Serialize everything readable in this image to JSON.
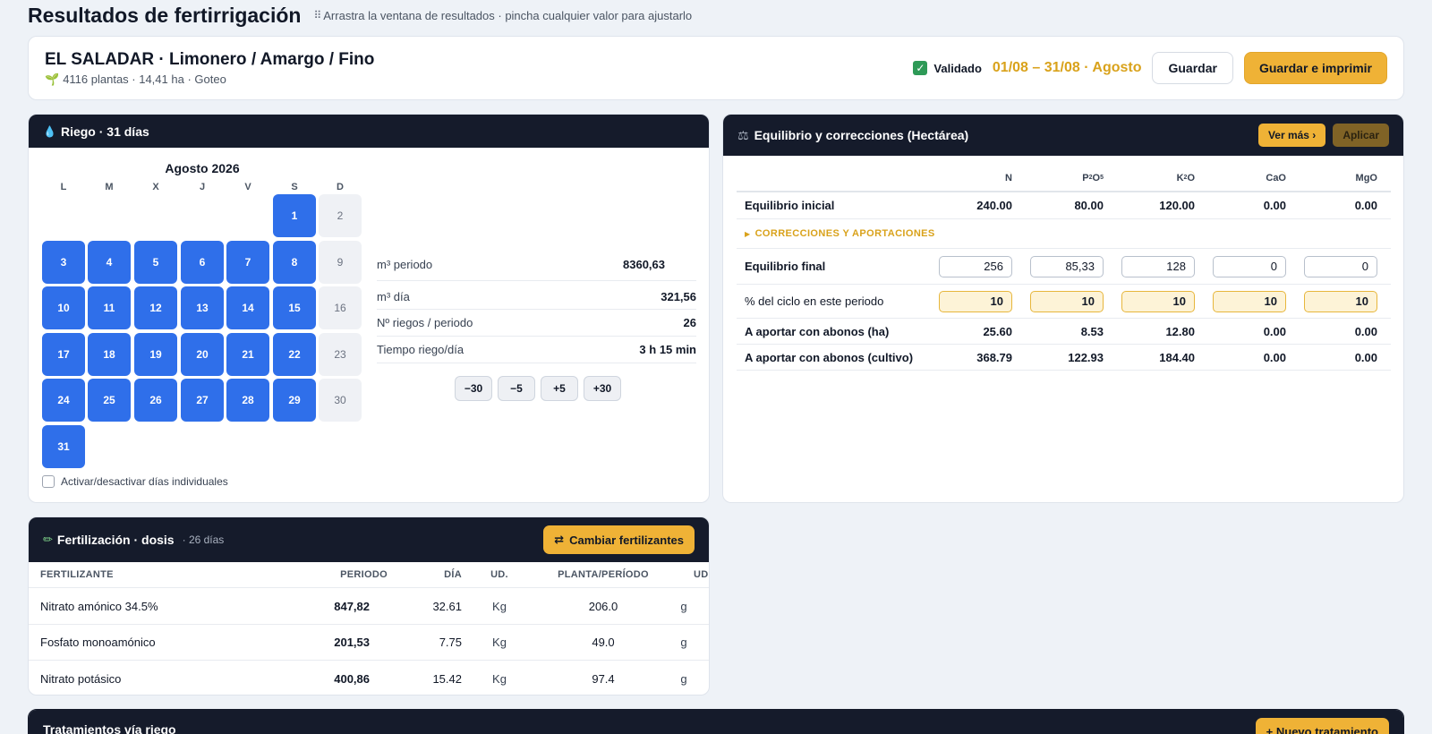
{
  "page": {
    "title": "Resultados de fertirrigación",
    "hint": "Arrastra la ventana de resultados · pincha cualquier valor para ajustarlo"
  },
  "summary": {
    "farm_title": "EL SALADAR · Limonero / Amargo / Fino",
    "farm_meta": "4116 plantas · 14,41 ha · Goteo",
    "validated_label": "Validado",
    "period": "01/08 – 31/08 · Agosto",
    "save_label": "Guardar",
    "save_print_label": "Guardar e imprimir"
  },
  "riego": {
    "title": "Riego · 31 días",
    "month": "Agosto 2026",
    "weekdays": [
      "L",
      "M",
      "X",
      "J",
      "V",
      "S",
      "D"
    ],
    "days": [
      {
        "n": "1",
        "active": true
      },
      {
        "n": "2",
        "active": false
      },
      {
        "n": "3",
        "active": true
      },
      {
        "n": "4",
        "active": true
      },
      {
        "n": "5",
        "active": true
      },
      {
        "n": "6",
        "active": true
      },
      {
        "n": "7",
        "active": true
      },
      {
        "n": "8",
        "active": true
      },
      {
        "n": "9",
        "active": false
      },
      {
        "n": "10",
        "active": true
      },
      {
        "n": "11",
        "active": true
      },
      {
        "n": "12",
        "active": true
      },
      {
        "n": "13",
        "active": true
      },
      {
        "n": "14",
        "active": true
      },
      {
        "n": "15",
        "active": true
      },
      {
        "n": "16",
        "active": false
      },
      {
        "n": "17",
        "active": true
      },
      {
        "n": "18",
        "active": true
      },
      {
        "n": "19",
        "active": true
      },
      {
        "n": "20",
        "active": true
      },
      {
        "n": "21",
        "active": true
      },
      {
        "n": "22",
        "active": true
      },
      {
        "n": "23",
        "active": false
      },
      {
        "n": "24",
        "active": true
      },
      {
        "n": "25",
        "active": true
      },
      {
        "n": "26",
        "active": true
      },
      {
        "n": "27",
        "active": true
      },
      {
        "n": "28",
        "active": true
      },
      {
        "n": "29",
        "active": true
      },
      {
        "n": "30",
        "active": false
      },
      {
        "n": "31",
        "active": true
      }
    ],
    "toggle_label": "Activar/desactivar días individuales",
    "stats": [
      {
        "label": "m³ periodo",
        "value": "8360,63"
      },
      {
        "label": "m³ día",
        "value": "321,56"
      },
      {
        "label": "Nº riegos / periodo",
        "value": "26"
      },
      {
        "label": "Tiempo riego/día",
        "value": "3 h 15 min"
      }
    ],
    "steppers": [
      "−30",
      "−5",
      "+5",
      "+30"
    ]
  },
  "equilibrio": {
    "title": "Equilibrio y correcciones (Hectárea)",
    "ver_mas_label": "Ver más ›",
    "aplicar_label": "Aplicar",
    "section_label": "CORRECCIONES Y APORTACIONES",
    "rows": [
      {
        "label": "Equilibrio inicial",
        "values": [
          "240.00",
          "80.00",
          "120.00",
          "0.00",
          "0.00"
        ]
      },
      {
        "label": "Equilibrio final",
        "values": [
          "256",
          "85,33",
          "128",
          "0",
          "0"
        ]
      },
      {
        "label": "% del ciclo en este periodo",
        "values": [
          "10",
          "10",
          "10",
          "10",
          "10"
        ]
      },
      {
        "label": "A aportar con abonos (ha)",
        "values": [
          "25.60",
          "8.53",
          "12.80",
          "0.00",
          "0.00"
        ]
      },
      {
        "label": "A aportar con abonos (cultivo)",
        "values": [
          "368.79",
          "122.93",
          "184.40",
          "0.00",
          "0.00"
        ]
      }
    ]
  },
  "fertilizacion": {
    "title": "Fertilización · dosis",
    "subtitle": "· 26 días",
    "change_label": "Cambiar fertilizantes",
    "columns": [
      "FERTILIZANTE",
      "PERIODO",
      "DÍA",
      "UD.",
      "PLANTA/PERÍODO",
      "UD."
    ],
    "rows": [
      {
        "name": "Nitrato amónico 34.5%",
        "periodo": "847,82",
        "dia": "32.61",
        "ud": "Kg",
        "planta": "206.0",
        "ud2": "g"
      },
      {
        "name": "Fosfato monoamónico",
        "periodo": "201,53",
        "dia": "7.75",
        "ud": "Kg",
        "planta": "49.0",
        "ud2": "g"
      },
      {
        "name": "Nitrato potásico",
        "periodo": "400,86",
        "dia": "15.42",
        "ud": "Kg",
        "planta": "97.4",
        "ud2": "g"
      }
    ]
  },
  "tratamientos": {
    "title": "Tratamientos vía riego",
    "new_label": "+ Nuevo tratamiento"
  },
  "colors": {
    "accent": "#efb236",
    "active_day": "#2f6fea",
    "header_dark": "#151b2b",
    "validated_green": "#2e9a57",
    "period_text": "#d9a21b"
  }
}
